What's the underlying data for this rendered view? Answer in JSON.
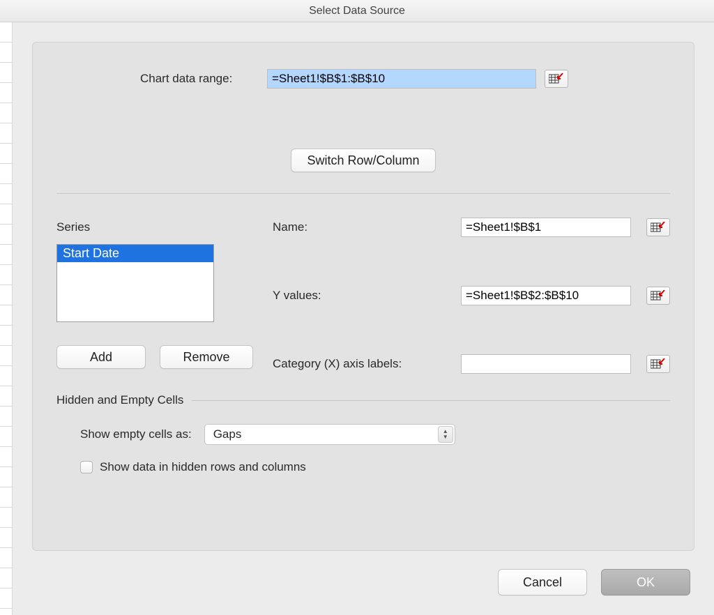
{
  "title": "Select Data Source",
  "chart_range": {
    "label": "Chart data range:",
    "value": "=Sheet1!$B$1:$B$10"
  },
  "switch_button": "Switch Row/Column",
  "series": {
    "heading": "Series",
    "items": [
      "Start Date"
    ],
    "selected_index": 0,
    "add_label": "Add",
    "remove_label": "Remove"
  },
  "fields": {
    "name": {
      "label": "Name:",
      "value": "=Sheet1!$B$1"
    },
    "y_values": {
      "label": "Y values:",
      "value": "=Sheet1!$B$2:$B$10"
    },
    "x_labels": {
      "label": "Category (X) axis labels:",
      "value": ""
    }
  },
  "hidden_empty": {
    "heading": "Hidden and Empty Cells",
    "show_empty_label": "Show empty cells as:",
    "show_empty_value": "Gaps",
    "show_hidden_label": "Show data in hidden rows and columns",
    "show_hidden_checked": false
  },
  "footer": {
    "cancel": "Cancel",
    "ok": "OK"
  }
}
